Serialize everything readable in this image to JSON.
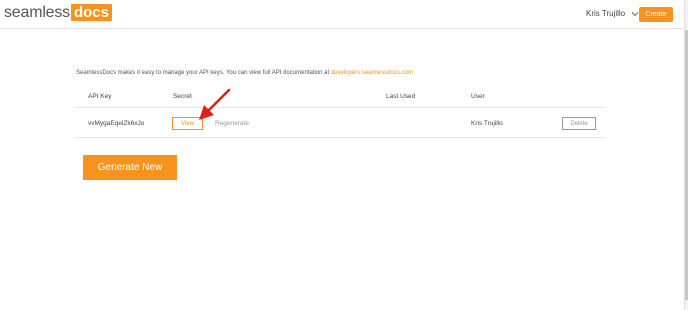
{
  "header": {
    "logo_part1": "seamless",
    "logo_part2": "docs",
    "user_name": "Kris Trujillo",
    "create_label": "Create"
  },
  "intro": {
    "text": "SeamlessDocs makes it easy to manage your API keys. You can view full API documentation at ",
    "link_text": "developers.seamlessdocs.com"
  },
  "table": {
    "headers": [
      "API Key",
      "Secret",
      "Last Used",
      "User"
    ],
    "rows": [
      {
        "api_key": "vvMygaEqelZk6xJo",
        "view_label": "View",
        "regenerate_label": "Regenerate",
        "last_used": "",
        "user": "Kris Trujillo",
        "delete_label": "Delete"
      }
    ]
  },
  "generate_label": "Generate New",
  "colors": {
    "accent": "#f7931e",
    "annotation_arrow": "#e02020"
  }
}
